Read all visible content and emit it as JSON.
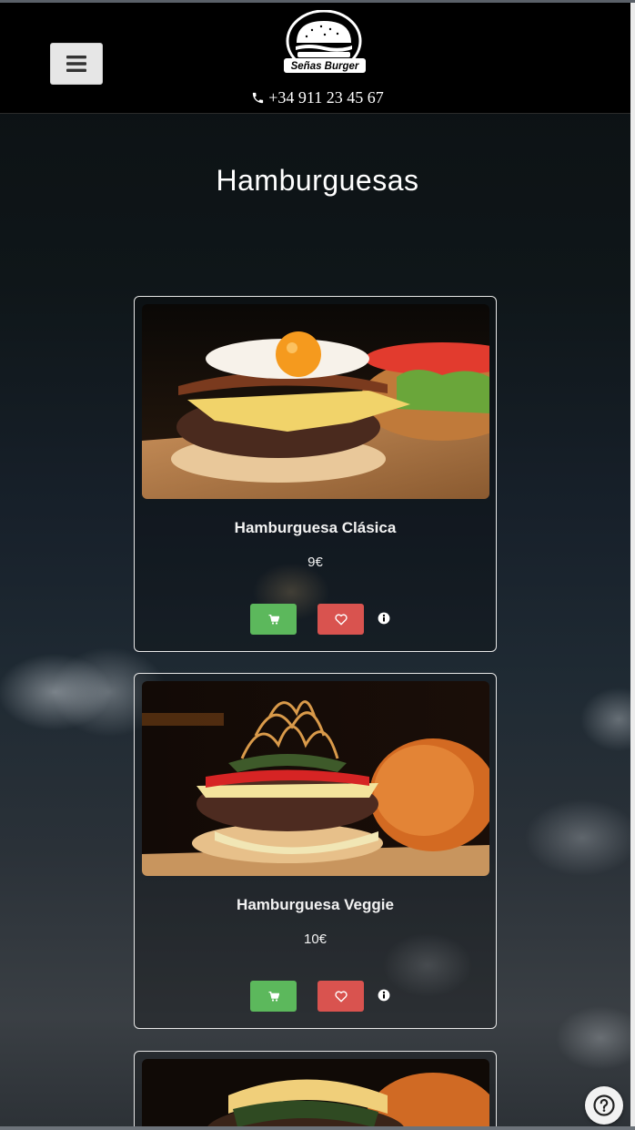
{
  "header": {
    "brand": "Señas Burger",
    "phone": "+34 911 23 45 67",
    "menu_icon": "hamburger-menu-icon",
    "phone_icon": "phone-icon"
  },
  "page": {
    "title": "Hamburguesas"
  },
  "products": [
    {
      "name": "Hamburguesa Clásica",
      "price": "9€"
    },
    {
      "name": "Hamburguesa Veggie",
      "price": "10€"
    },
    {
      "name": "",
      "price": ""
    }
  ],
  "actions": {
    "cart_icon": "shopping-cart-icon",
    "fav_icon": "heart-icon",
    "info_icon": "info-icon"
  },
  "colors": {
    "cart_button": "#5cb85c",
    "fav_button": "#d9534f",
    "header_bg": "#000000"
  },
  "help": {
    "icon": "question-icon"
  }
}
